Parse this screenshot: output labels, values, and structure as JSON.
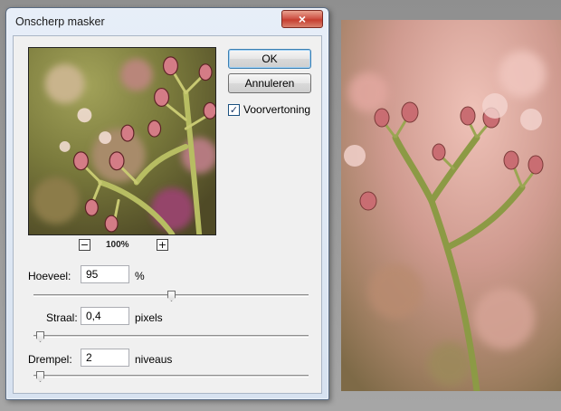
{
  "dialog": {
    "title": "Onscherp masker",
    "close_symbol": "×",
    "ok_label": "OK",
    "cancel_label": "Annuleren",
    "preview_toggle": {
      "label": "Voorvertoning",
      "checked": true,
      "check_mark": "✓"
    },
    "zoom": {
      "minus": "−",
      "plus": "+",
      "level": "100%"
    },
    "fields": {
      "amount": {
        "label": "Hoeveel:",
        "value": "95",
        "unit": "%",
        "slider_fraction": 0.5
      },
      "radius": {
        "label": "Straal:",
        "value": "0,4",
        "unit": "pixels",
        "slider_fraction": 0.01
      },
      "threshold": {
        "label": "Drempel:",
        "value": "2",
        "unit": "niveaus",
        "slider_fraction": 0.01
      }
    }
  },
  "colors": {
    "window_frame": "#d7e2f0",
    "close_red": "#c63e2f",
    "default_button_border": "#3c7fb1"
  }
}
